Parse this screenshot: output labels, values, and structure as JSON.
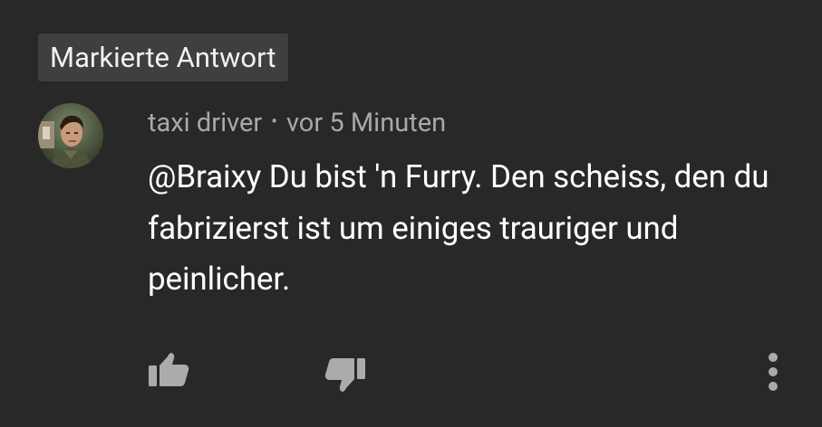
{
  "badge": {
    "label": "Markierte Antwort"
  },
  "comment": {
    "author": "taxi driver",
    "separator": "•",
    "time": "vor 5 Minuten",
    "text": "@Braixy Du bist 'n Furry. Den scheiss, den du fabrizierst ist um einiges trauriger und peinlicher."
  },
  "actions": {
    "like_icon": "thumbs-up-icon",
    "dislike_icon": "thumbs-down-icon",
    "more_icon": "more-vert-icon"
  },
  "colors": {
    "background": "#282828",
    "badge_bg": "#3f3f3f",
    "meta_text": "#a8a8a8",
    "body_text": "#ffffff",
    "icon": "#ababab"
  }
}
